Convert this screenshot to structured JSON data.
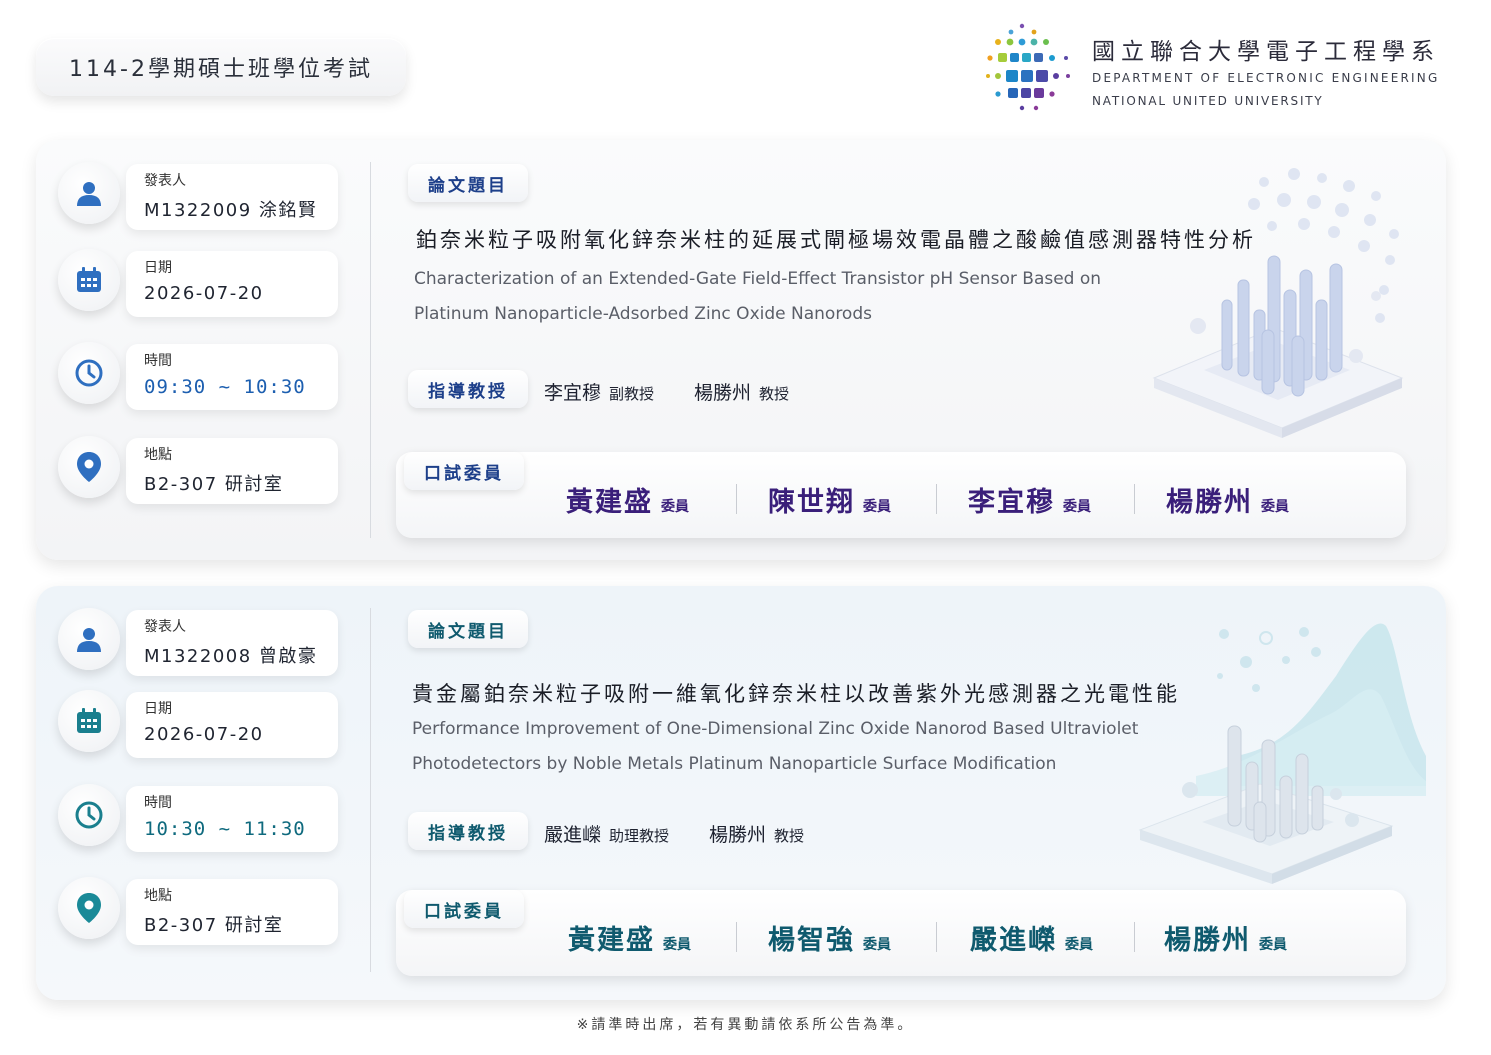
{
  "header": {
    "title": "114-2學期碩士班學位考試"
  },
  "logo": {
    "zh": "國立聯合大學電子工程學系",
    "en_line1": "DEPARTMENT OF ELECTRONIC ENGINEERING",
    "en_line2": "NATIONAL UNITED UNIVERSITY"
  },
  "labels": {
    "presenter": "發表人",
    "date": "日期",
    "time": "時間",
    "location": "地點",
    "thesis_title": "論文題目",
    "advisors": "指導教授",
    "committee": "口試委員",
    "member_role": "委員"
  },
  "colors": {
    "card1_accent": "#1d3f8a",
    "card1_name": "#3a1f7a",
    "card2_accent": "#0f5a6e",
    "card2_name": "#0f5a6e"
  },
  "sessions": [
    {
      "presenter": "M1322009 涂銘賢",
      "date": "2026-07-20",
      "time": "09:30 ~ 10:30",
      "location": "B2-307 研討室",
      "title_zh": "鉑奈米粒子吸附氧化鋅奈米柱的延展式閘極場效電晶體之酸鹼值感測器特性分析",
      "title_en_line1": "Characterization of an Extended-Gate Field-Effect Transistor pH Sensor Based on",
      "title_en_line2": "Platinum Nanoparticle-Adsorbed Zinc Oxide Nanorods",
      "advisors": [
        {
          "name": "李宜穆",
          "rank": "副教授"
        },
        {
          "name": "楊勝州",
          "rank": "教授"
        }
      ],
      "committee": [
        "黃建盛",
        "陳世翔",
        "李宜穆",
        "楊勝州"
      ]
    },
    {
      "presenter": "M1322008 曾啟豪",
      "date": "2026-07-20",
      "time": "10:30 ~ 11:30",
      "location": "B2-307 研討室",
      "title_zh": "貴金屬鉑奈米粒子吸附一維氧化鋅奈米柱以改善紫外光感測器之光電性能",
      "title_en_line1": "Performance Improvement of One-Dimensional Zinc Oxide Nanorod Based Ultraviolet",
      "title_en_line2": "Photodetectors by Noble Metals Platinum Nanoparticle Surface Modification",
      "advisors": [
        {
          "name": "嚴進嶸",
          "rank": "助理教授"
        },
        {
          "name": "楊勝州",
          "rank": "教授"
        }
      ],
      "committee": [
        "黃建盛",
        "楊智強",
        "嚴進嶸",
        "楊勝州"
      ]
    }
  ],
  "footer": "※請準時出席，若有異動請依系所公告為準。"
}
